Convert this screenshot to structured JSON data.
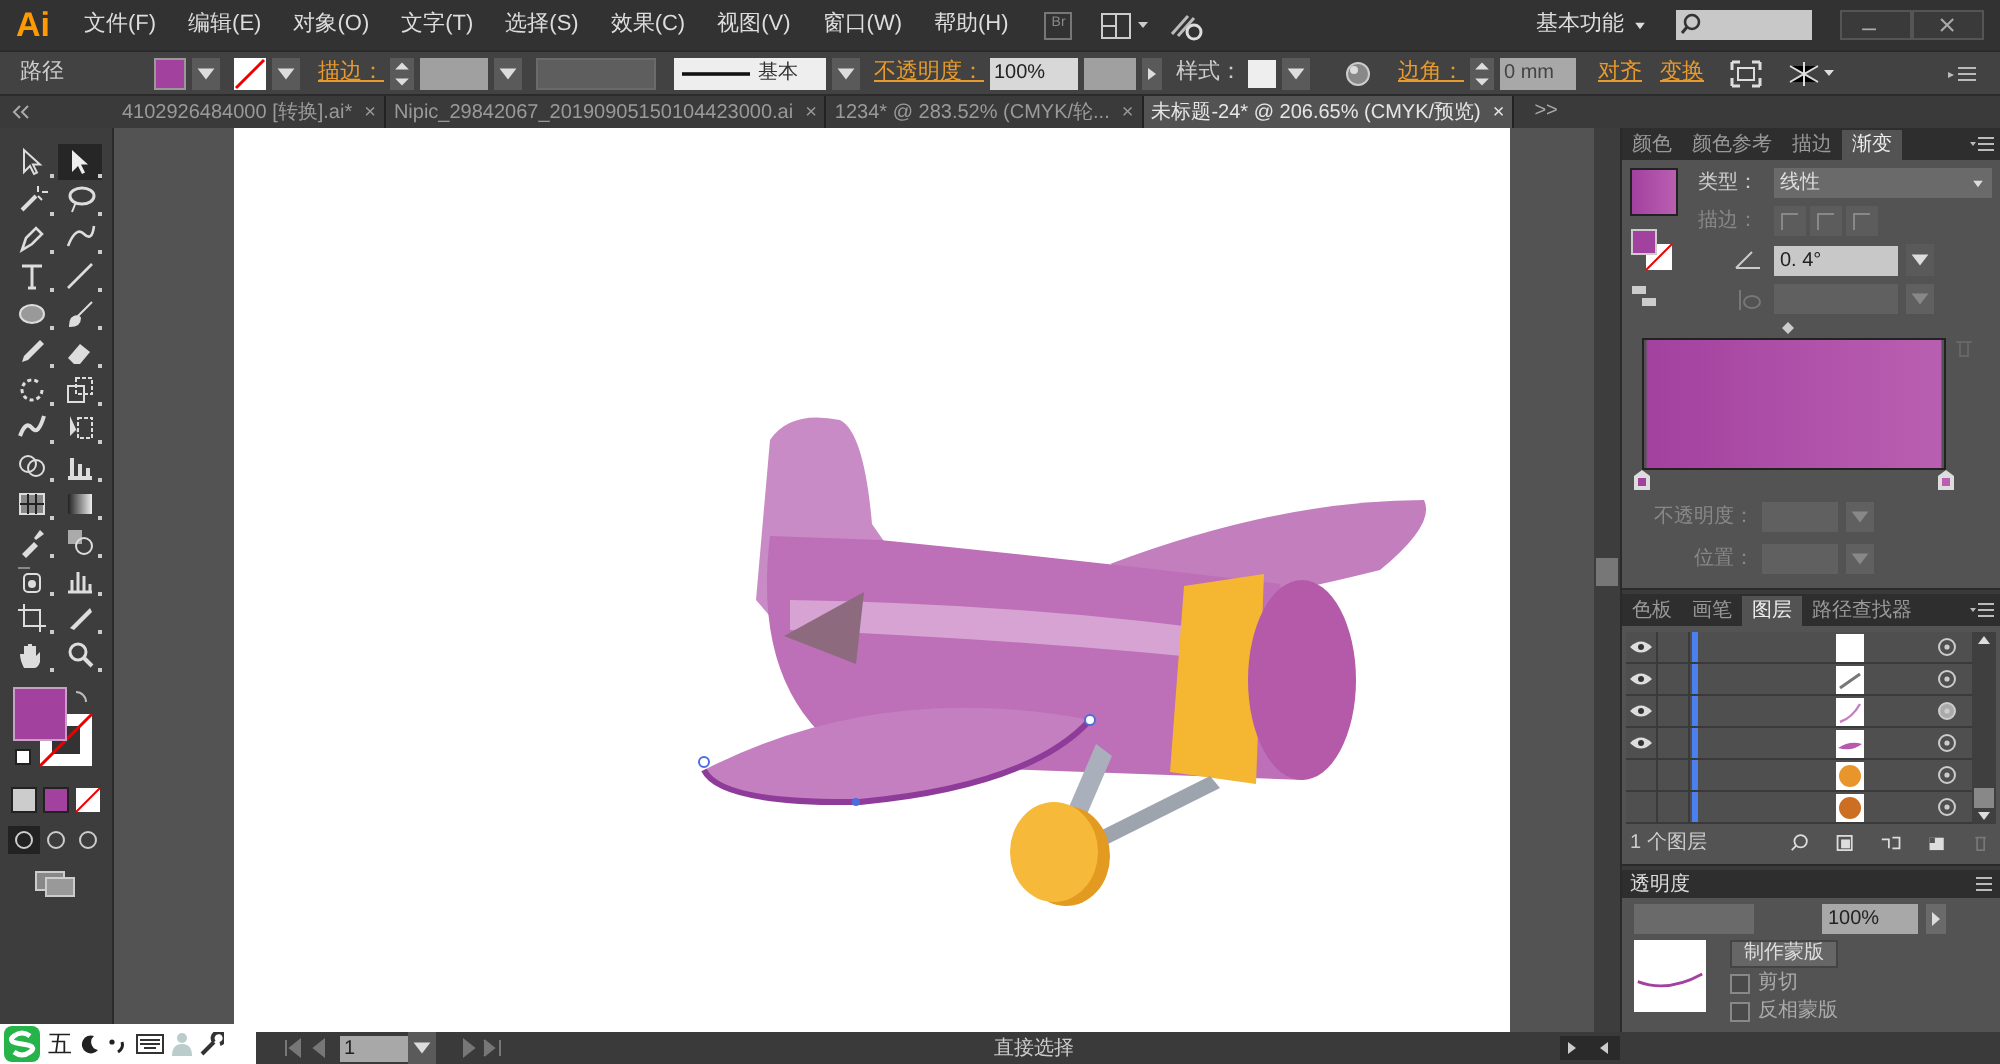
{
  "app": {
    "logo": "Ai",
    "menus": [
      "文件(F)",
      "编辑(E)",
      "对象(O)",
      "文字(T)",
      "选择(S)",
      "效果(C)",
      "视图(V)",
      "窗口(W)",
      "帮助(H)"
    ],
    "bridge": "Br",
    "workspace": "基本功能"
  },
  "control_bar": {
    "selection": "路径",
    "stroke_label": "描边：",
    "profile": "基本",
    "opacity_label": "不透明度：",
    "opacity": "100%",
    "style_label": "样式：",
    "corner_label": "边角：",
    "corner": "0 mm",
    "align": "对齐",
    "transform": "变换"
  },
  "documents": [
    {
      "title": "4102926484000 [转换].ai*",
      "close": "×",
      "selected": false
    },
    {
      "title": "Nipic_29842067_20190905150104423000.ai",
      "close": "×",
      "selected": false
    },
    {
      "title": "1234* @ 283.52% (CMYK/轮...",
      "close": "×",
      "selected": false
    },
    {
      "title": "未标题-24* @ 206.65% (CMYK/预览)",
      "close": "×",
      "selected": true
    }
  ],
  "documents_overflow": ">>",
  "tools": [
    {
      "kind": "select",
      "selected": false
    },
    {
      "kind": "direct",
      "selected": true
    },
    {
      "kind": "wand",
      "selected": false
    },
    {
      "kind": "lasso",
      "selected": false
    },
    {
      "kind": "pen",
      "selected": false
    },
    {
      "kind": "curvature",
      "selected": false
    },
    {
      "kind": "type",
      "selected": false
    },
    {
      "kind": "line",
      "selected": false
    },
    {
      "kind": "ellipse",
      "selected": false
    },
    {
      "kind": "brush",
      "selected": false
    },
    {
      "kind": "pencil",
      "selected": false
    },
    {
      "kind": "eraser",
      "selected": false
    },
    {
      "kind": "rotate",
      "selected": false
    },
    {
      "kind": "scale",
      "selected": false
    },
    {
      "kind": "warp",
      "selected": false
    },
    {
      "kind": "transform",
      "selected": false
    },
    {
      "kind": "builder",
      "selected": false
    },
    {
      "kind": "chart",
      "selected": false
    },
    {
      "kind": "mesh",
      "selected": false
    },
    {
      "kind": "gradient",
      "selected": false
    },
    {
      "kind": "eyedropper",
      "selected": false
    },
    {
      "kind": "blend",
      "selected": false
    },
    {
      "kind": "symbol",
      "selected": false
    },
    {
      "kind": "graph",
      "selected": false
    },
    {
      "kind": "artboard",
      "selected": false
    },
    {
      "kind": "slice",
      "selected": false
    },
    {
      "kind": "hand",
      "selected": false
    },
    {
      "kind": "zoom",
      "selected": false
    }
  ],
  "gradient_panel": {
    "tabs": [
      {
        "label": "颜色",
        "selected": false
      },
      {
        "label": "颜色参考",
        "selected": false
      },
      {
        "label": "描边",
        "selected": false
      },
      {
        "label": "渐变",
        "selected": true
      }
    ],
    "type_label": "类型：",
    "type": "线性",
    "stroke_label": "描边：",
    "angle": "0. 4°",
    "opacity_label": "不透明度：",
    "position_label": "位置："
  },
  "layers_panel": {
    "tabs": [
      {
        "label": "色板",
        "selected": false
      },
      {
        "label": "画笔",
        "selected": false
      },
      {
        "label": "图层",
        "selected": true
      },
      {
        "label": "路径查找器",
        "selected": false
      }
    ],
    "rows": [
      {
        "visible": true,
        "kind": "blank",
        "selected": false
      },
      {
        "visible": true,
        "kind": "line",
        "selected": false
      },
      {
        "visible": true,
        "kind": "curve",
        "selected": true
      },
      {
        "visible": true,
        "kind": "wing",
        "selected": false
      },
      {
        "visible": false,
        "kind": "ball",
        "selected": false
      },
      {
        "visible": false,
        "kind": "disc",
        "selected": false
      }
    ],
    "count": "1 个图层"
  },
  "transparency_panel": {
    "title": "透明度",
    "opacity": "100%",
    "make_mask": "制作蒙版",
    "options": [
      {
        "label": "剪切",
        "checked": false
      },
      {
        "label": "反相蒙版",
        "checked": false
      }
    ]
  },
  "status_bar": {
    "page": "1",
    "tool": "直接选择"
  },
  "ime": {
    "mode": "五"
  }
}
